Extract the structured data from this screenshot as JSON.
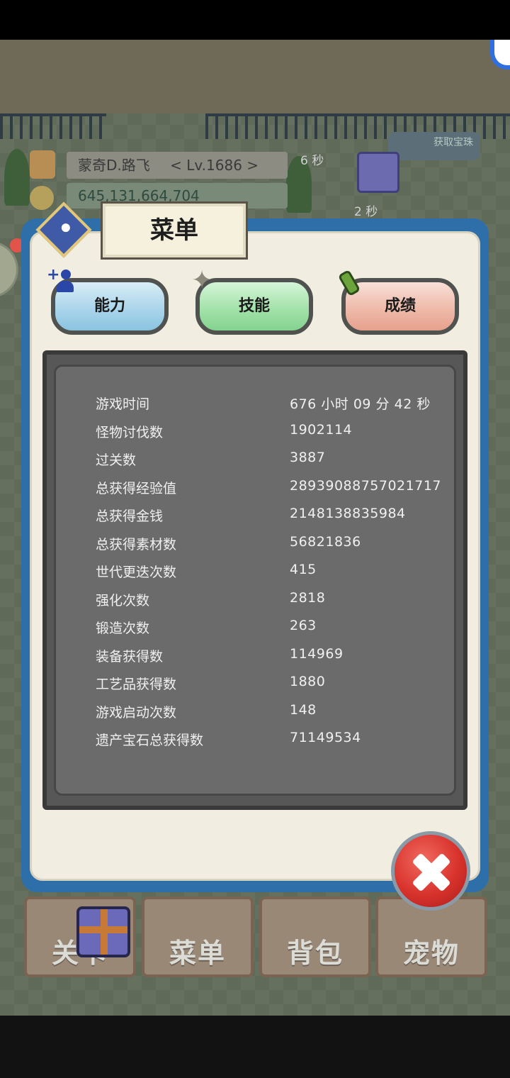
{
  "hud": {
    "player_name": "蒙奇D.路飞",
    "level": "< Lv.1686 >",
    "gold": "645,131,664,704",
    "timer_top": "6 秒",
    "timer_gift": "2 秒",
    "extra_button_label": "获取宝珠"
  },
  "modal": {
    "title": "菜单",
    "tabs": [
      {
        "label": "能力",
        "icon": "person-plus-icon"
      },
      {
        "label": "技能",
        "icon": "star-icon"
      },
      {
        "label": "成绩",
        "icon": "scroll-icon"
      }
    ],
    "stats": [
      {
        "label": "游戏时间",
        "value": "676 小时 09 分 42 秒"
      },
      {
        "label": "怪物讨伐数",
        "value": "1902114"
      },
      {
        "label": "过关数",
        "value": "3887"
      },
      {
        "label": "总获得经验值",
        "value": "28939088757021717"
      },
      {
        "label": "总获得金钱",
        "value": "2148138835984"
      },
      {
        "label": "总获得素材数",
        "value": "56821836"
      },
      {
        "label": "世代更迭次数",
        "value": "415"
      },
      {
        "label": "强化次数",
        "value": "2818"
      },
      {
        "label": "锻造次数",
        "value": "263"
      },
      {
        "label": "装备获得数",
        "value": "114969"
      },
      {
        "label": "工艺品获得数",
        "value": "1880"
      },
      {
        "label": "游戏启动次数",
        "value": "148"
      },
      {
        "label": "遗产宝石总获得数",
        "value": "71149534"
      }
    ]
  },
  "bottom_nav": {
    "items": [
      {
        "label": "关卡"
      },
      {
        "label": "菜单"
      },
      {
        "label": "背包"
      },
      {
        "label": "宠物"
      }
    ]
  },
  "colors": {
    "modal_border": "#2e6faa",
    "stats_bg": "#6b6b6b",
    "close_red": "#d8322c"
  }
}
